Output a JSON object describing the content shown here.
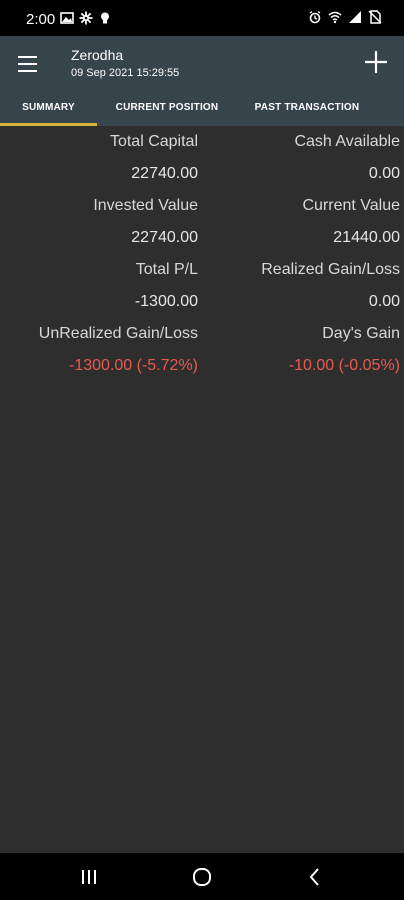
{
  "status_bar": {
    "time": "2:00",
    "left_icons": [
      "image-icon",
      "settings-gear-icon",
      "bulb-icon"
    ],
    "right_icons": [
      "alarm-icon",
      "wifi-icon",
      "signal-icon",
      "no-sim-icon"
    ]
  },
  "app_bar": {
    "title": "Zerodha",
    "subtitle": "09 Sep 2021 15:29:55",
    "menu_icon": "hamburger-menu-icon",
    "add_icon": "plus-icon"
  },
  "tabs": [
    {
      "label": "SUMMARY",
      "active": true
    },
    {
      "label": "CURRENT POSITION",
      "active": false
    },
    {
      "label": "PAST TRANSACTION",
      "active": false
    }
  ],
  "colors": {
    "background": "#2e2e2e",
    "app_bar": "#36444c",
    "tab_indicator": "#d6b23a",
    "negative": "#e85a4f"
  },
  "summary": {
    "total_capital_label": "Total Capital",
    "total_capital_value": "22740.00",
    "cash_available_label": "Cash Available",
    "cash_available_value": "0.00",
    "invested_value_label": "Invested Value",
    "invested_value_value": "22740.00",
    "current_value_label": "Current Value",
    "current_value_value": "21440.00",
    "total_pl_label": "Total P/L",
    "total_pl_value": "-1300.00",
    "realized_label": "Realized Gain/Loss",
    "realized_value": "0.00",
    "unrealized_label": "UnRealized Gain/Loss",
    "unrealized_value": "-1300.00 (-5.72%)",
    "days_gain_label": "Day's Gain",
    "days_gain_value": "-10.00 (-0.05%)"
  },
  "nav_bar": {
    "recents_icon": "recents-icon",
    "home_icon": "home-icon",
    "back_icon": "back-icon"
  }
}
